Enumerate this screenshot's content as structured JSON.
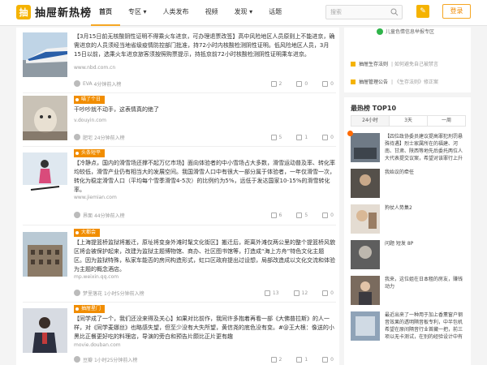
{
  "header": {
    "logo_glyph": "抽",
    "logo_text": "抽屉新热榜",
    "nav": [
      "首页",
      "专区 ▾",
      "人类发布",
      "视频",
      "发现 ▾",
      "话题"
    ],
    "search_placeholder": "搜索",
    "edit_glyph": "✎",
    "login": "登录"
  },
  "colors": {
    "accent": "#f5b301",
    "tag": "#f18d00",
    "brand_text": "#222222"
  },
  "posts": [
    {
      "tag": "",
      "title": "【3月15日前无核酸阴性证明不得乘火车进京，可办理退票改签】高中风险地区人员原则上不能进京，确需进京的人员须经当地省级疫情防控部门批准，持72小时内核酸检测阴性证明。低风险地区人员，3月15日以前，选乘火车进京旅客须按照购票提示，持抵京前72小时核酸检测阴性证明乘车进京。",
      "source": "www.nbd.com.cn",
      "author": "EVA",
      "time": "4分钟前入榜",
      "likes": "2",
      "comments": "0",
      "shares": "0"
    },
    {
      "tag": "喵了个日",
      "title": "干吵吵就不动手，这表情真的绝了",
      "source": "v.douyin.com",
      "author": "肥宅",
      "time": "24分钟前入榜",
      "likes": "5",
      "comments": "1",
      "shares": "0"
    },
    {
      "tag": "头条短平",
      "title": "【冷静点，国内的滑雪场还撑不起万亿市场】面向体验者的中小雪场占大多数，滑雪运动普及率、转化率均较低，滑雪产业仍有相当大的发展空间。我国滑雪人口中有很大一部分属于体验者，一年仅滑雪一次，转化为稳定滑雪人口（平均每个雪季滑雪4-5次）的比例约为5%，远低于发达国家10-15%的滑雪转化率。",
      "source": "www.jiemian.com",
      "author": "界面",
      "time": "44分钟前入榜",
      "likes": "6",
      "comments": "5",
      "shares": "0"
    },
    {
      "tag": "大都会",
      "title": "【上海提篮桥监狱将搬迁，原址将变身外滩时髦文化街区】搬迁后，距离外滩仅两公里的整个提篮桥风貌区将会被保护起来，改建为监狱主题博物馆、商办、社区图书馆等，打造成“海上方舟”特色文化主题区。因为监狱特殊，私家车能否的房间构造形式，虹口区政府提出过设想，局部改造成以文化交流和体验为主题的概念酒店。",
      "source": "mp.weixin.qq.com",
      "author": "梦里落花",
      "time": "1小时5分钟前入榜",
      "likes": "13",
      "comments": "12",
      "shares": "0"
    },
    {
      "tag": "抽屉星门",
      "title": "【同学成了一个，我们还没来得及关心】如果对比前作，我同许多抱着再看一部《大佛普拉斯》的人一样，对《同学麦娜丝》也略感失望，但至少没有大失所望，黄信尧的底色没有变。#@王大根：像送的小黑比正餐更好吃的料理店，导演的旁白和预告片颇比正片更有趣",
      "source": "movie.douban.com",
      "author": "豆瓣",
      "time": "1小时25分钟前入榜",
      "likes": "2",
      "comments": "1",
      "shares": "0"
    }
  ],
  "sidebar": {
    "check_text": "儿童色情信息举报专区",
    "links": [
      {
        "label": "抽屉生存法则",
        "sub": "| 如何避免自己被禁言"
      },
      {
        "label": "抽屉管理公告",
        "sub": "| 《生存法则》修正案"
      }
    ],
    "top_title": "最热榜 TOP10",
    "tabs": [
      "24小时",
      "3天",
      "一周"
    ],
    "rank_items": [
      "【四位政协委员建议提高罪犯刑罚悬殊待遇】烈士家属所在的福建、河南、甘肃、陕西等地先后委托两位人大代表提交议案，希望对该罪行上升为罪犯刑罚。",
      "我始议的牵任",
      "狗仗人势集2",
      "问题 短发 8P",
      "我来，这位姐在日本租的房友，赚钱动力",
      "最近出来了一种用于加上香薰窗户钢音效果的透明隔音板专利，中半包机希望在原间隔音行业首藏一把，前三项以无卡测试，在别的经验设计中有更多开发试验的发展型号，经过前边测试，即可经过一些..."
    ]
  }
}
